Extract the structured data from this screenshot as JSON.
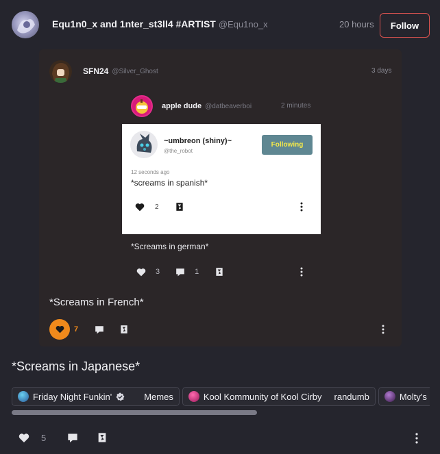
{
  "post": {
    "author": "Equ1n0_x and 1nter_st3ll4 #ARTIST",
    "handle": "@Equ1no_x",
    "time": "20 hours",
    "follow_label": "Follow",
    "body": "*Screams in Japanese*",
    "likes": "5"
  },
  "reblog1": {
    "author": "SFN24",
    "handle": "@Silver_Ghost",
    "time": "3 days",
    "body": "*Screams in French*",
    "likes": "7"
  },
  "reblog2": {
    "author": "apple dude",
    "handle": "@datbeaverboi",
    "time": "2 minutes",
    "body": "*Screams in german*",
    "likes": "3",
    "comments": "1"
  },
  "original": {
    "author": "~umbreon (shiny)~",
    "handle": "@the_robot",
    "following_label": "Following",
    "time": "12 seconds ago",
    "body": "*screams in spanish*",
    "likes": "2"
  },
  "communities": [
    {
      "name": "Friday Night Funkin'",
      "tag": "Memes",
      "verified": true
    },
    {
      "name": "Kool Kommunity of Kool Cirby",
      "tag": "randumb"
    },
    {
      "name": "Molty's C"
    }
  ],
  "colors": {
    "accent_red": "#d9534f",
    "like_orange": "#f08a1c",
    "following_teal": "#5f8792"
  }
}
